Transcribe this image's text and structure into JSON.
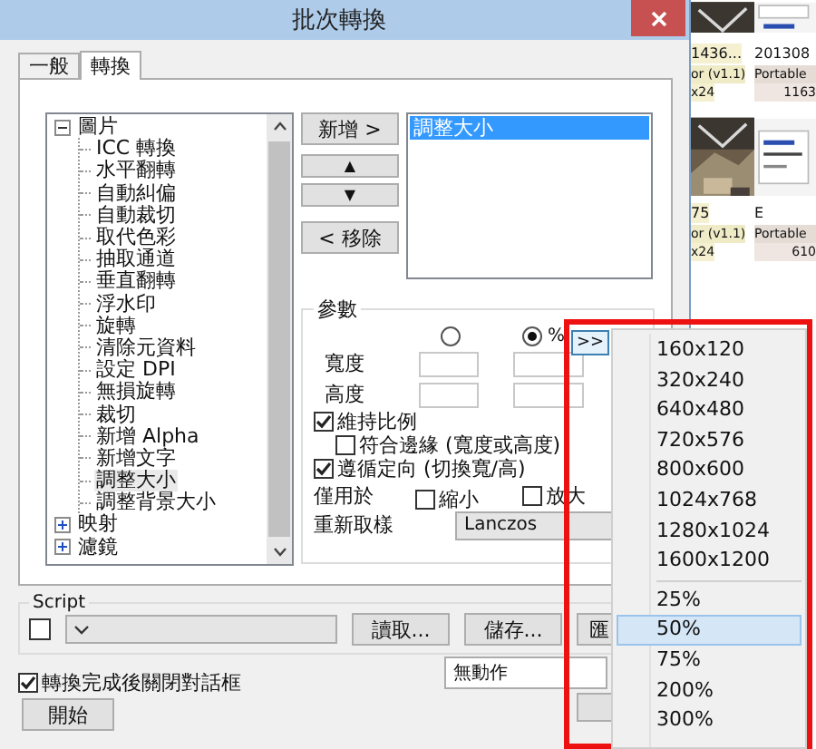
{
  "window": {
    "title": "批次轉換"
  },
  "tabs": [
    {
      "label": "一般",
      "selected": false
    },
    {
      "label": "轉換",
      "selected": true
    }
  ],
  "tree": [
    {
      "label": "圖片",
      "expanded": true,
      "selected": false,
      "children": [
        {
          "label": "ICC 轉換",
          "selected": false
        },
        {
          "label": "水平翻轉",
          "selected": false
        },
        {
          "label": "自動糾偏",
          "selected": false
        },
        {
          "label": "自動裁切",
          "selected": false
        },
        {
          "label": "取代色彩",
          "selected": false
        },
        {
          "label": "抽取通道",
          "selected": false
        },
        {
          "label": "垂直翻轉",
          "selected": false
        },
        {
          "label": "浮水印",
          "selected": false
        },
        {
          "label": "旋轉",
          "selected": false
        },
        {
          "label": "清除元資料",
          "selected": false
        },
        {
          "label": "設定 DPI",
          "selected": false
        },
        {
          "label": "無損旋轉",
          "selected": false
        },
        {
          "label": "裁切",
          "selected": false
        },
        {
          "label": "新增 Alpha",
          "selected": false
        },
        {
          "label": "新增文字",
          "selected": false
        },
        {
          "label": "調整大小",
          "selected": true
        },
        {
          "label": "調整背景大小",
          "selected": false
        }
      ]
    },
    {
      "label": "映射",
      "expanded": false,
      "selected": false
    },
    {
      "label": "濾鏡",
      "expanded": false,
      "selected": false
    }
  ],
  "action_buttons": [
    {
      "kind": "wide",
      "label": "新增 >"
    },
    {
      "kind": "arrow",
      "label": "▲"
    },
    {
      "kind": "arrow",
      "label": "▼"
    },
    {
      "kind": "wide",
      "label": "< 移除"
    }
  ],
  "filter_list": [
    {
      "label": "調整大小",
      "selected": true
    }
  ],
  "params": {
    "title": "參數",
    "units": [
      {
        "selected": false
      },
      {
        "label": "%",
        "selected": true
      }
    ],
    "fields": [
      {
        "label": "寬度"
      },
      {
        "label": "高度"
      }
    ],
    "options": [
      {
        "label": "維持比例",
        "checked": true,
        "children": [
          {
            "label": "符合邊緣 (寬度或高度)",
            "checked": false
          }
        ]
      },
      {
        "label": "遵循定向 (切換寬/高)",
        "checked": true
      }
    ],
    "apply_to": {
      "label": "僅用於",
      "options": [
        {
          "label": "縮小",
          "checked": false
        },
        {
          "label": "放大",
          "checked": false
        }
      ]
    },
    "resample": {
      "label": "重新取樣",
      "value": "Lanczos"
    }
  },
  "script": {
    "title": "Script",
    "enabled": false,
    "buttons": [
      "讀取...",
      "儲存...",
      "匯"
    ]
  },
  "close_after": {
    "label": "轉換完成後關閉對話框",
    "checked": true
  },
  "after_action": {
    "value": "無動作"
  },
  "start_button": "開始",
  "preset_button": ">>",
  "preset_menu": [
    {
      "kind": "item",
      "label": "160x120",
      "selected": false
    },
    {
      "kind": "item",
      "label": "320x240",
      "selected": false
    },
    {
      "kind": "item",
      "label": "640x480",
      "selected": false
    },
    {
      "kind": "item",
      "label": "720x576",
      "selected": false
    },
    {
      "kind": "item",
      "label": "800x600",
      "selected": false
    },
    {
      "kind": "item",
      "label": "1024x768",
      "selected": false
    },
    {
      "kind": "item",
      "label": "1280x1024",
      "selected": false
    },
    {
      "kind": "item",
      "label": "1600x1200",
      "selected": false
    },
    {
      "kind": "separator"
    },
    {
      "kind": "item",
      "label": "25%",
      "selected": false
    },
    {
      "kind": "item",
      "label": "50%",
      "selected": true
    },
    {
      "kind": "item",
      "label": "75%",
      "selected": false
    },
    {
      "kind": "item",
      "label": "200%",
      "selected": false
    },
    {
      "kind": "item",
      "label": "300%",
      "selected": false
    }
  ],
  "background_thumbs": [
    {
      "name": "1436...",
      "format": "or (v1.1)",
      "info": "x24"
    },
    {
      "name": "201308",
      "format": "Portable",
      "info": "1163"
    },
    {
      "name": "75",
      "format": "or (v1.1)",
      "info": "x24"
    },
    {
      "name": "E",
      "format": "Portable",
      "info": "610"
    }
  ]
}
